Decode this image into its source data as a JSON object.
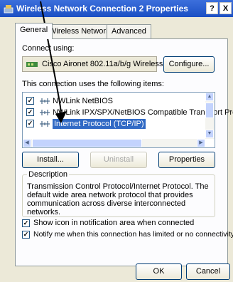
{
  "window": {
    "title": "Wireless Network Connection 2 Properties",
    "help_label": "?",
    "close_label": "X"
  },
  "tabs": [
    {
      "label": "General"
    },
    {
      "label": "Wireless Networks"
    },
    {
      "label": "Advanced"
    }
  ],
  "general": {
    "connect_using_label": "Connect using:",
    "adapter_name": "Cisco Aironet 802.11a/b/g Wireless",
    "configure_label": "Configure...",
    "items_label": "This connection uses the following items:",
    "items": [
      {
        "label": "NWLink NetBIOS",
        "checked": true
      },
      {
        "label": "NWLink IPX/SPX/NetBIOS Compatible Transport Prot",
        "checked": true
      },
      {
        "label": "Internet Protocol (TCP/IP)",
        "checked": true,
        "selected": true
      }
    ],
    "install_label": "Install...",
    "uninstall_label": "Uninstall",
    "properties_label": "Properties",
    "description_label": "Description",
    "description_text": "Transmission Control Protocol/Internet Protocol. The default wide area network protocol that provides communication across diverse interconnected networks.",
    "show_icon_label": "Show icon in notification area when connected",
    "show_icon_checked": true,
    "notify_label": "Notify me when this connection has limited or no connectivity",
    "notify_checked": true
  },
  "footer": {
    "ok_label": "OK",
    "cancel_label": "Cancel"
  },
  "colors": {
    "titlebar": "#1b4fc4",
    "selection": "#316ac5",
    "annotation_arrow": "#000000"
  }
}
